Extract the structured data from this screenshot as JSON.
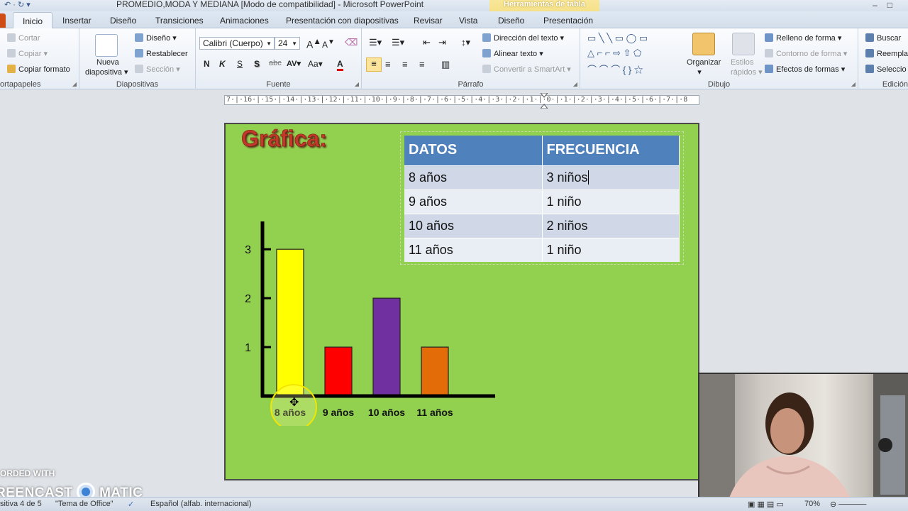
{
  "window": {
    "title": "PROMEDIO,MODA Y MEDIANA [Modo de compatibilidad]  -  Microsoft PowerPoint",
    "context_tab_group": "Herramientas de tabla"
  },
  "tabs": [
    "Inicio",
    "Insertar",
    "Diseño",
    "Transiciones",
    "Animaciones",
    "Presentación con diapositivas",
    "Revisar",
    "Vista",
    "Diseño",
    "Presentación"
  ],
  "active_tab": "Inicio",
  "ribbon": {
    "portapapeles": {
      "cut": "Cortar",
      "copy": "Copiar",
      "format_painter": "Copiar formato",
      "label": "ortapapeles"
    },
    "diapositivas": {
      "new_slide_1": "Nueva",
      "new_slide_2": "diapositiva",
      "layout": "Diseño",
      "reset": "Restablecer",
      "section": "Sección",
      "label": "Diapositivas"
    },
    "fuente": {
      "font_name": "Calibri (Cuerpo)",
      "font_size": "24",
      "bold": "N",
      "italic": "K",
      "underline": "S",
      "shadow": "S",
      "strike": "abc",
      "spacing": "AV",
      "case": "Aa",
      "label": "Fuente"
    },
    "parrafo": {
      "text_direction": "Dirección del texto",
      "align_text": "Alinear texto",
      "smartart": "Convertir a SmartArt",
      "label": "Párrafo"
    },
    "dibujo": {
      "arrange": "Organizar",
      "quick_styles_1": "Estilos",
      "quick_styles_2": "rápidos",
      "fill": "Relleno de forma",
      "outline": "Contorno de forma",
      "effects": "Efectos de formas",
      "label": "Dibujo"
    },
    "edicion": {
      "find": "Buscar",
      "replace": "Reempla",
      "select": "Seleccio",
      "label": "Edición"
    }
  },
  "ruler_text": "7·|·16·|·15·|·14·|·13·|·12·|·11·|·10·|·9·|·8·|·7·|·6·|·5·|·4·|·3·|·2·|·1·|·0·|·1·|·2·|·3·|·4·|·5·|·6·|·7·|·8",
  "slide": {
    "title": "Gráfica:",
    "table": {
      "headers": [
        "DATOS",
        "FRECUENCIA"
      ],
      "rows": [
        [
          "8 años",
          "3  niños"
        ],
        [
          "9 años",
          "1  niño"
        ],
        [
          "10 años",
          "2 niños"
        ],
        [
          "11 años",
          "1 niño"
        ]
      ]
    }
  },
  "chart_data": {
    "type": "bar",
    "categories": [
      "8 años",
      "9 años",
      "10 años",
      "11 años"
    ],
    "values": [
      3,
      1,
      2,
      1
    ],
    "colors": [
      "#ffff00",
      "#ff0000",
      "#7030a0",
      "#e36c09"
    ],
    "yticks": [
      1,
      2,
      3
    ],
    "ylim": [
      0,
      3
    ]
  },
  "watermark": {
    "line1": "ORDED WITH",
    "line2": "REENCAST",
    "line3": "MATIC"
  },
  "statusbar": {
    "slide_info": "sitiva 4 de 5",
    "theme": "\"Tema de Office\"",
    "language": "Español (alfab. internacional)",
    "zoom": "70%"
  }
}
